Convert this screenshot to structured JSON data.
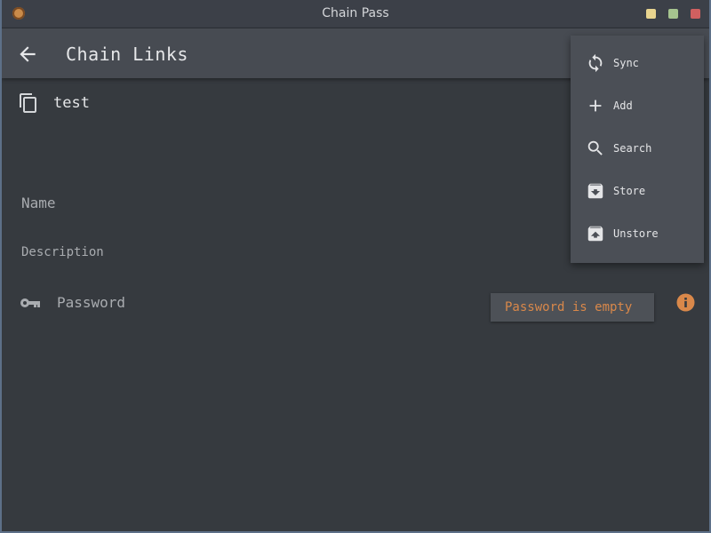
{
  "window": {
    "title": "Chain Pass"
  },
  "appbar": {
    "title": "Chain Links"
  },
  "chain": {
    "name": "test"
  },
  "form": {
    "name_label": "Name",
    "description_label": "Description",
    "password_label": "Password",
    "password_error": "Password is empty"
  },
  "menu": {
    "items": [
      {
        "label": "Sync",
        "icon": "sync-icon"
      },
      {
        "label": "Add",
        "icon": "add-icon"
      },
      {
        "label": "Search",
        "icon": "search-icon"
      },
      {
        "label": "Store",
        "icon": "store-icon"
      },
      {
        "label": "Unstore",
        "icon": "unstore-icon"
      }
    ]
  },
  "colors": {
    "error": "#d9884a",
    "background": "#363a3f",
    "appbar": "#474b52",
    "menu": "#4b4f56"
  }
}
